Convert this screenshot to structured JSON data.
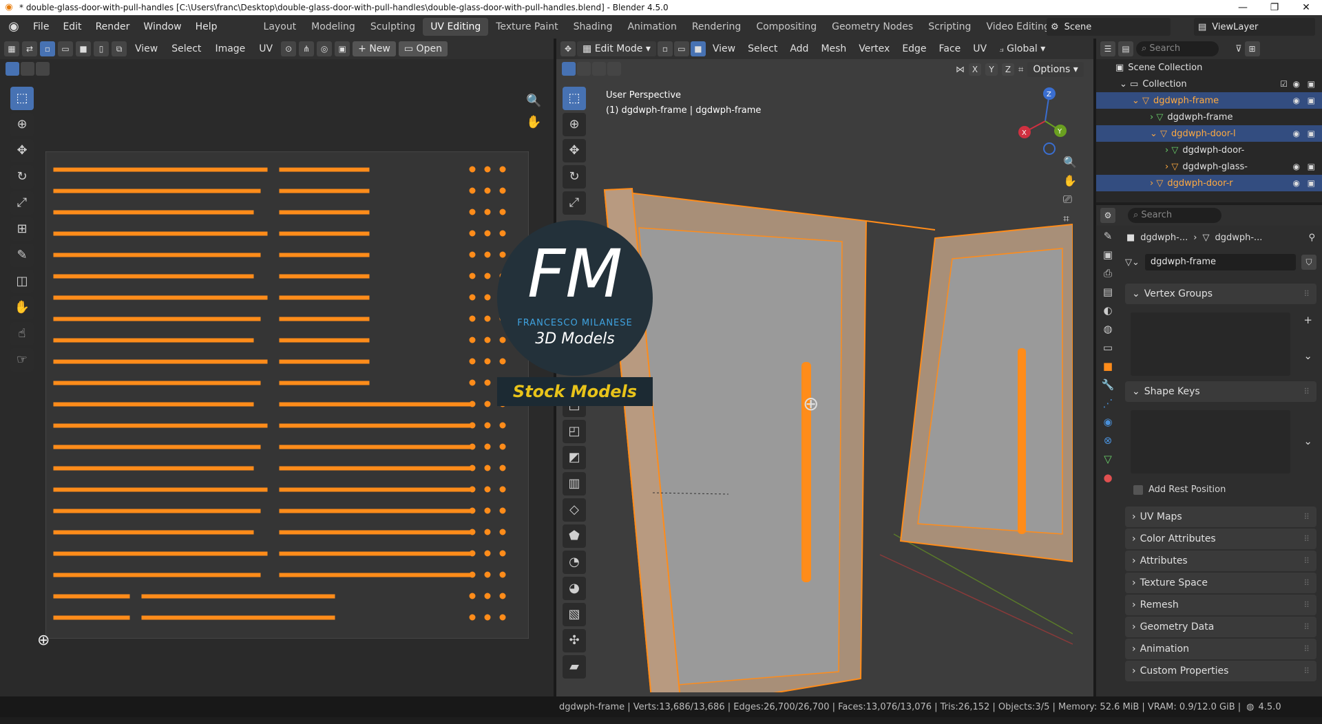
{
  "titlebar": {
    "title": "* double-glass-door-with-pull-handles [C:\\Users\\franc\\Desktop\\double-glass-door-with-pull-handles\\double-glass-door-with-pull-handles.blend] - Blender 4.5.0",
    "min": "—",
    "max": "❐",
    "close": "✕"
  },
  "menus": [
    "File",
    "Edit",
    "Render",
    "Window",
    "Help"
  ],
  "workspaces": [
    "Layout",
    "Modeling",
    "Sculpting",
    "UV Editing",
    "Texture Paint",
    "Shading",
    "Animation",
    "Rendering",
    "Compositing",
    "Geometry Nodes",
    "Scripting",
    "Video Editing",
    "+"
  ],
  "active_workspace": "UV Editing",
  "scene": {
    "name": "Scene",
    "view_layer": "ViewLayer"
  },
  "uv_editor": {
    "menus": [
      "View",
      "Select",
      "Image",
      "UV"
    ],
    "new_label": "New",
    "open_label": "Open"
  },
  "viewport": {
    "mode": "Edit Mode",
    "menus": [
      "View",
      "Select",
      "Add",
      "Mesh",
      "Vertex",
      "Edge",
      "Face",
      "UV"
    ],
    "transform": "Global",
    "options": "Options",
    "axes": [
      "X",
      "Y",
      "Z"
    ],
    "overlay_line1": "User Perspective",
    "overlay_line2": "(1) dgdwph-frame | dgdwph-frame",
    "gizmo": {
      "x": "X",
      "y": "Y",
      "z": "Z"
    }
  },
  "watermark": {
    "initials": "FM",
    "name": "FRANCESCO MILANESE",
    "sub": "3D Models",
    "banner": "Stock Models"
  },
  "outliner": {
    "search": "Search",
    "collection_root": "Scene Collection",
    "items": [
      {
        "label": "Collection"
      },
      {
        "label": "dgdwph-frame"
      },
      {
        "label": "dgdwph-frame"
      },
      {
        "label": "dgdwph-door-l"
      },
      {
        "label": "dgdwph-door-"
      },
      {
        "label": "dgdwph-glass-"
      },
      {
        "label": "dgdwph-door-r"
      }
    ]
  },
  "properties": {
    "search": "Search",
    "breadcrumb_1": "dgdwph-...",
    "breadcrumb_2": "dgdwph-...",
    "mesh_name": "dgdwph-frame",
    "vertex_groups": "Vertex Groups",
    "shape_keys": "Shape Keys",
    "add_rest": "Add Rest Position",
    "sections": [
      "UV Maps",
      "Color Attributes",
      "Attributes",
      "Texture Space",
      "Remesh",
      "Geometry Data",
      "Animation",
      "Custom Properties"
    ]
  },
  "statusbar": {
    "text": "dgdwph-frame | Verts:13,686/13,686 | Edges:26,700/26,700 | Faces:13,076/13,076 | Tris:26,152 | Objects:3/5 | Memory: 52.6 MiB | VRAM: 0.9/12.0 GiB |",
    "version": "4.5.0"
  },
  "colors": {
    "accent": "#4772b3",
    "selection": "#ff8c1a",
    "active_workspace": "#474747"
  }
}
